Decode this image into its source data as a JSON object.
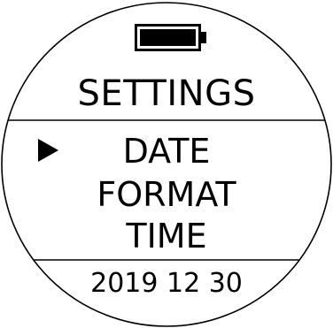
{
  "screen": {
    "title": "SETTINGS",
    "battery_icon": "battery-full-icon",
    "selector_icon": "play-triangle-icon",
    "menu_items": [
      {
        "label": "DATE",
        "selected": true
      },
      {
        "label": "FORMAT",
        "selected": false
      },
      {
        "label": "TIME",
        "selected": false
      }
    ],
    "footer_date": "2019 12 30",
    "battery_level": 1.0
  },
  "colors": {
    "foreground": "#000000",
    "background": "#ffffff"
  }
}
